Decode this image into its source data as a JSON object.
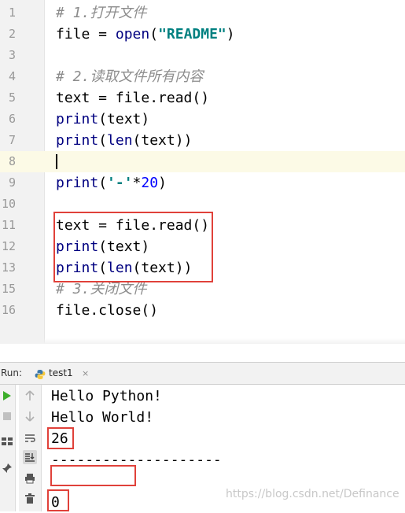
{
  "editor": {
    "lines": [
      {
        "num": "1",
        "tokens": [
          {
            "t": "# 1.打开文件",
            "c": "cm"
          }
        ]
      },
      {
        "num": "2",
        "tokens": [
          {
            "t": "file = "
          },
          {
            "t": "open",
            "c": "bi"
          },
          {
            "t": "("
          },
          {
            "t": "\"README\"",
            "c": "str"
          },
          {
            "t": ")"
          }
        ]
      },
      {
        "num": "3",
        "tokens": []
      },
      {
        "num": "4",
        "tokens": [
          {
            "t": "# 2.读取文件所有内容",
            "c": "cm"
          }
        ]
      },
      {
        "num": "5",
        "tokens": [
          {
            "t": "text = file.read()"
          }
        ]
      },
      {
        "num": "6",
        "tokens": [
          {
            "t": "print",
            "c": "bi"
          },
          {
            "t": "(text)"
          }
        ]
      },
      {
        "num": "7",
        "tokens": [
          {
            "t": "print",
            "c": "bi"
          },
          {
            "t": "("
          },
          {
            "t": "len",
            "c": "bi"
          },
          {
            "t": "(text))"
          }
        ]
      },
      {
        "num": "8",
        "tokens": [],
        "current": true
      },
      {
        "num": "9",
        "tokens": [
          {
            "t": "print",
            "c": "bi"
          },
          {
            "t": "("
          },
          {
            "t": "'-'",
            "c": "str"
          },
          {
            "t": "*"
          },
          {
            "t": "20",
            "c": "num"
          },
          {
            "t": ")"
          }
        ]
      },
      {
        "num": "10",
        "tokens": []
      },
      {
        "num": "11",
        "tokens": [
          {
            "t": "text = file.read()"
          }
        ]
      },
      {
        "num": "12",
        "tokens": [
          {
            "t": "print",
            "c": "bi"
          },
          {
            "t": "(text)"
          }
        ]
      },
      {
        "num": "13",
        "tokens": [
          {
            "t": "print",
            "c": "bi"
          },
          {
            "t": "("
          },
          {
            "t": "len",
            "c": "bi"
          },
          {
            "t": "(text))"
          }
        ]
      },
      {
        "num": "15",
        "tokens": [
          {
            "t": "# 3.关闭文件",
            "c": "cm"
          }
        ]
      },
      {
        "num": "16",
        "tokens": [
          {
            "t": "file.close()"
          }
        ]
      }
    ]
  },
  "run": {
    "label": "Run:",
    "tab_name": "test1",
    "tab_close": "×",
    "output": [
      "Hello Python!",
      "Hello World!",
      "26",
      "--------------------",
      "",
      "0"
    ]
  },
  "watermark": "https://blog.csdn.net/Definance",
  "colors": {
    "highlight_border": "#e0413a",
    "run_green": "#3dae2b"
  }
}
